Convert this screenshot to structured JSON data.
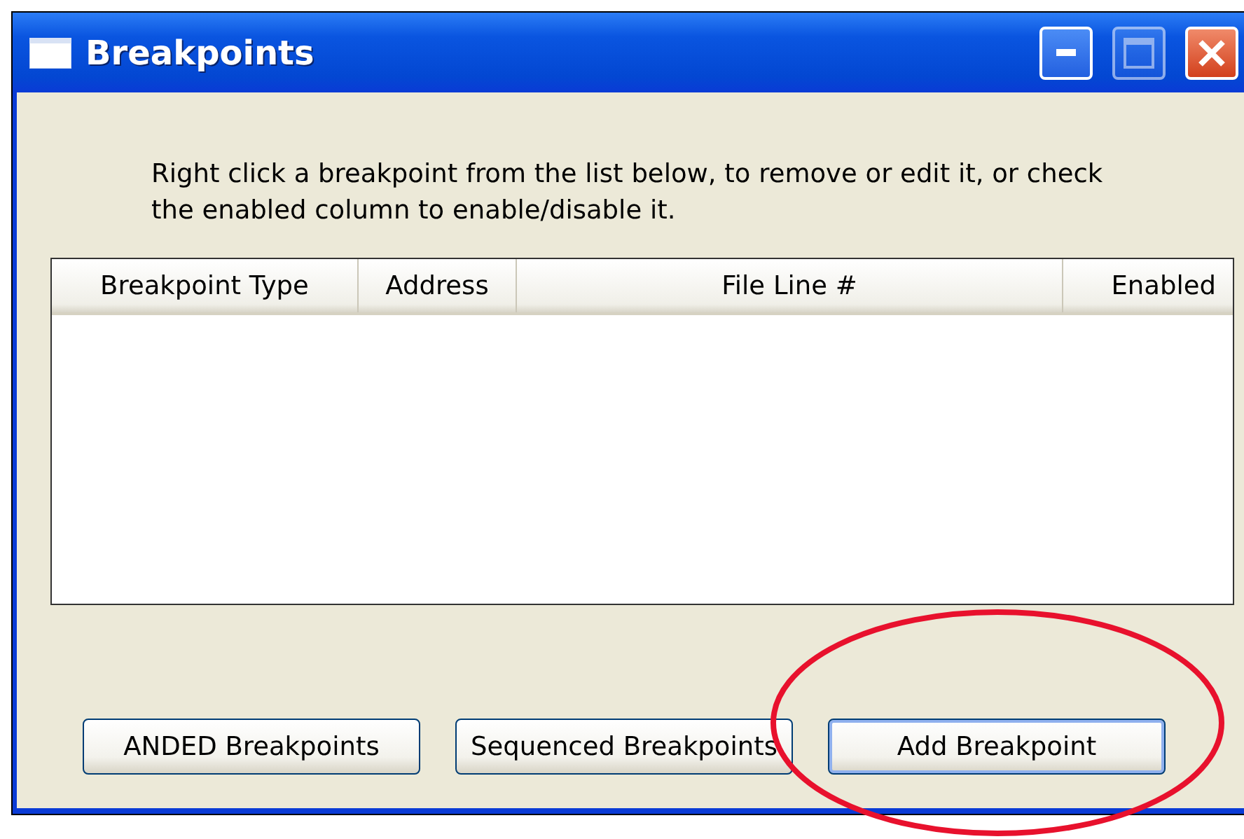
{
  "window": {
    "title": "Breakpoints",
    "controls": [
      {
        "kind": "minimize",
        "disabled": false
      },
      {
        "kind": "maximize",
        "disabled": true
      },
      {
        "kind": "close",
        "disabled": false
      }
    ]
  },
  "instructions": "Right click a breakpoint from the list below, to remove or edit it, or check the enabled column to enable/disable it.",
  "table": {
    "columns": [
      {
        "label": "Breakpoint Type"
      },
      {
        "label": "Address"
      },
      {
        "label": "File Line #"
      },
      {
        "label": "Enabled"
      }
    ]
  },
  "buttons": [
    {
      "label": "ANDED Breakpoints",
      "default": false
    },
    {
      "label": "Sequenced Breakpoints",
      "default": false
    },
    {
      "label": "Add Breakpoint",
      "default": true
    }
  ],
  "annotation": {
    "kind": "ellipse",
    "color": "#e8112d"
  }
}
